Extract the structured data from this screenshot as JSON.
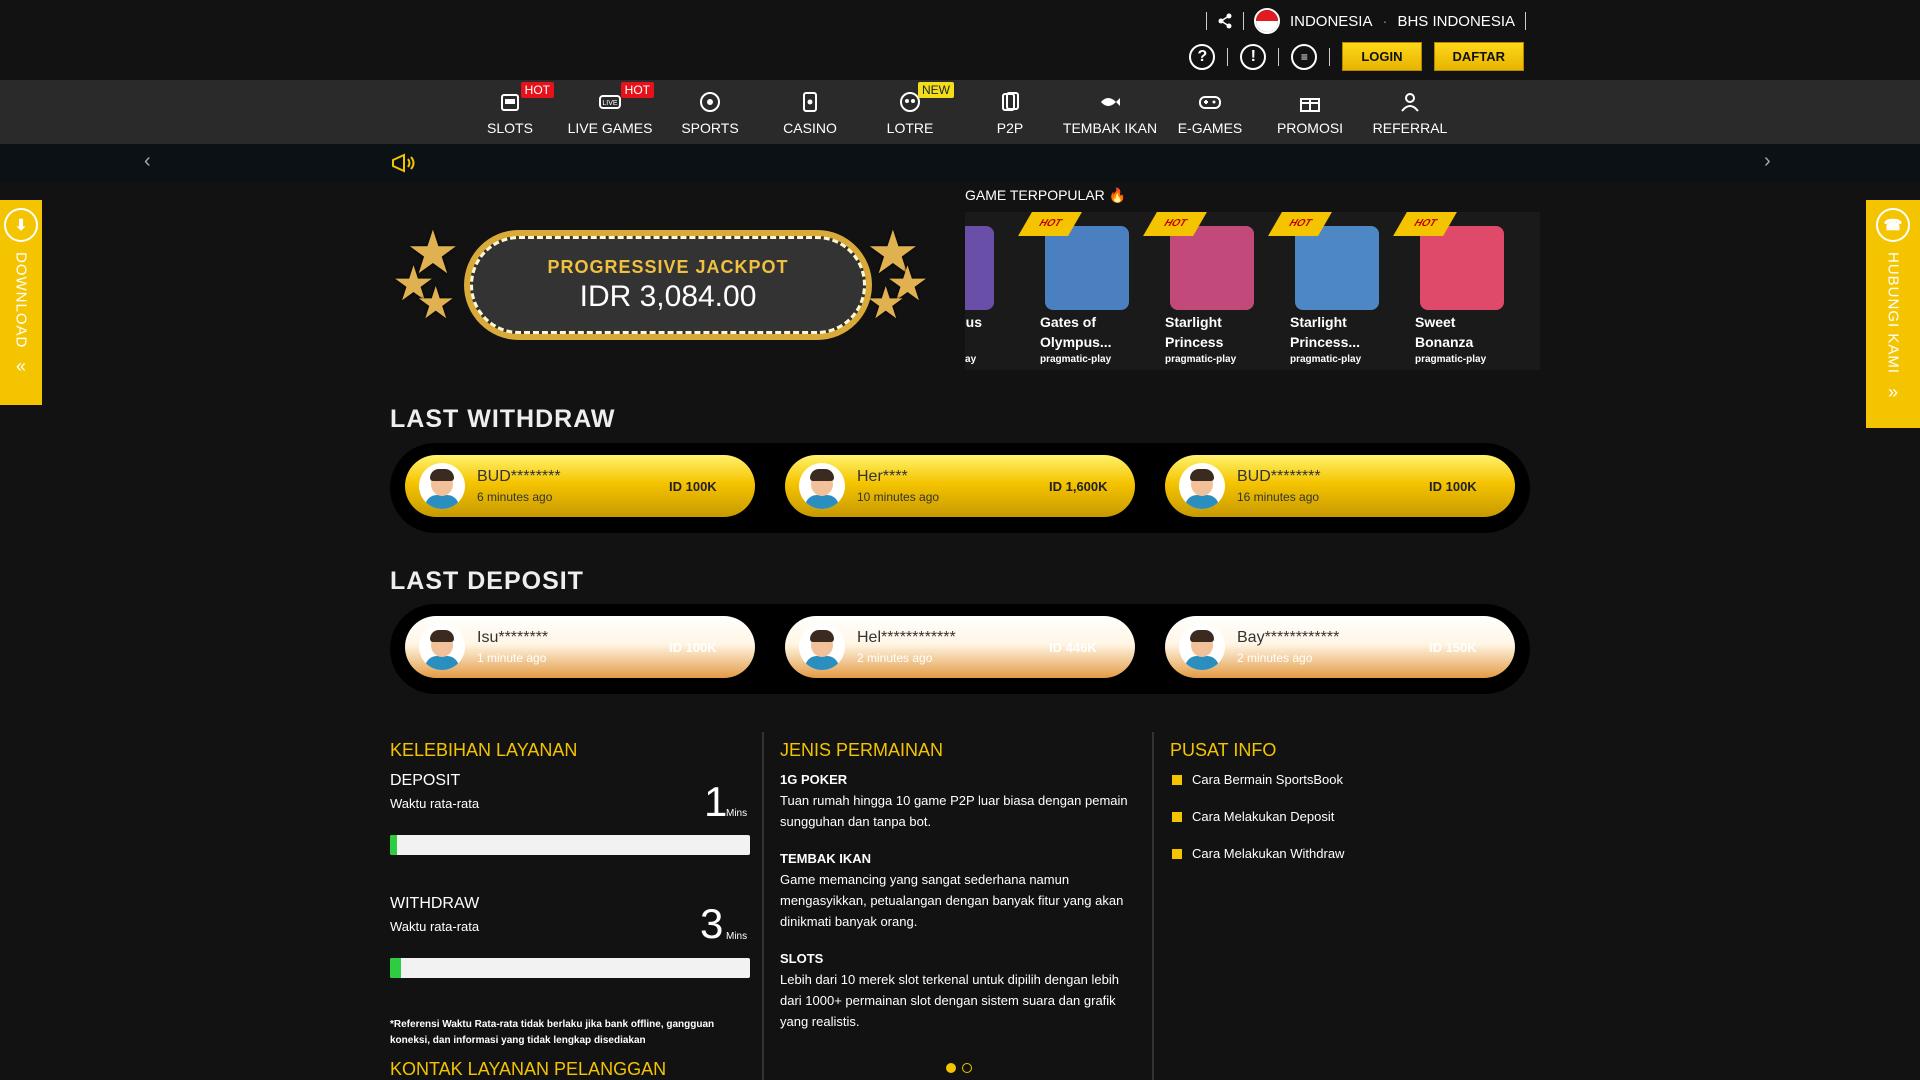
{
  "topbar": {
    "language": "INDONESIA",
    "language_alt": "BHS INDONESIA",
    "login_label": "LOGIN",
    "register_label": "DAFTAR"
  },
  "nav": {
    "items": [
      {
        "label": "SLOTS",
        "icon": "slot-machine-icon",
        "badge": "HOT"
      },
      {
        "label": "LIVE GAMES",
        "icon": "live-icon",
        "badge": "HOT"
      },
      {
        "label": "SPORTS",
        "icon": "soccer-ball-icon",
        "badge": ""
      },
      {
        "label": "CASINO",
        "icon": "card-icon",
        "badge": ""
      },
      {
        "label": "LOTRE",
        "icon": "lottery-icon",
        "badge": "NEW"
      },
      {
        "label": "P2P",
        "icon": "cards-icon",
        "badge": ""
      },
      {
        "label": "TEMBAK IKAN",
        "icon": "fish-icon",
        "badge": ""
      },
      {
        "label": "E-GAMES",
        "icon": "gamepad-icon",
        "badge": ""
      },
      {
        "label": "PROMOSI",
        "icon": "gift-icon",
        "badge": ""
      },
      {
        "label": "REFERRAL",
        "icon": "referral-icon",
        "badge": ""
      }
    ]
  },
  "side": {
    "download": "DOWNLOAD",
    "contact": "HUBUNGI KAMI"
  },
  "jackpot": {
    "title": "PROGRESSIVE JACKPOT",
    "value": "IDR 3,084.00"
  },
  "popular": {
    "title": "GAME TERPOPULAR",
    "games": [
      {
        "name": "of\nOlympus",
        "provider": "pragmatic-play",
        "ribbon": "",
        "color": "#6a4fa8"
      },
      {
        "name": "Gates of Olympus...",
        "provider": "pragmatic-play",
        "ribbon": "HOT",
        "color": "#4a7fc0"
      },
      {
        "name": "Starlight Princess",
        "provider": "pragmatic-play",
        "ribbon": "HOT",
        "color": "#c14a7a"
      },
      {
        "name": "Starlight Princess...",
        "provider": "pragmatic-play",
        "ribbon": "HOT",
        "color": "#4e88c4"
      },
      {
        "name": "Sweet Bonanza",
        "provider": "pragmatic-play",
        "ribbon": "HOT",
        "color": "#e04a6a"
      }
    ]
  },
  "withdraw": {
    "title": "LAST WITHDRAW",
    "items": [
      {
        "name": "BUD********",
        "time": "6 minutes ago",
        "amount": "ID 100K"
      },
      {
        "name": "Her****",
        "time": "10 minutes ago",
        "amount": "ID 1,600K"
      },
      {
        "name": "BUD********",
        "time": "16 minutes ago",
        "amount": "ID 100K"
      }
    ]
  },
  "deposit": {
    "title": "LAST DEPOSIT",
    "items": [
      {
        "name": "Isu********",
        "time": "1 minute ago",
        "amount": "ID 100K"
      },
      {
        "name": "Hel************",
        "time": "2 minutes ago",
        "amount": "ID 446K"
      },
      {
        "name": "Bay************",
        "time": "2 minutes ago",
        "amount": "ID 150K"
      }
    ]
  },
  "service": {
    "title": "KELEBIHAN LAYANAN",
    "deposit_label": "DEPOSIT",
    "deposit_sub": "Waktu rata-rata",
    "deposit_num": "1",
    "deposit_unit": "Mins",
    "deposit_progress": 0.02,
    "withdraw_label": "WITHDRAW",
    "withdraw_sub": "Waktu rata-rata",
    "withdraw_num": "3",
    "withdraw_unit": "Mins",
    "withdraw_progress": 0.03,
    "note": "*Referensi Waktu Rata-rata tidak berlaku jika bank offline, gangguan koneksi, dan informasi yang tidak lengkap disediakan",
    "contact_title": "KONTAK LAYANAN PELANGGAN"
  },
  "games_info": {
    "title": "JENIS PERMAINAN",
    "items": [
      {
        "title": "1G POKER",
        "desc": "Tuan rumah hingga 10 game P2P luar biasa dengan pemain sungguhan dan tanpa bot."
      },
      {
        "title": "TEMBAK IKAN",
        "desc": "Game memancing yang sangat sederhana namun mengasyikkan, petualangan dengan banyak fitur yang akan dinikmati banyak orang."
      },
      {
        "title": "SLOTS",
        "desc": "Lebih dari 10 merek slot terkenal untuk dipilih dengan lebih dari 1000+ permainan slot dengan sistem suara dan grafik yang realistis."
      }
    ]
  },
  "info_center": {
    "title": "PUSAT INFO",
    "links": [
      "Cara Bermain SportsBook",
      "Cara Melakukan Deposit",
      "Cara Melakukan Withdraw"
    ]
  }
}
